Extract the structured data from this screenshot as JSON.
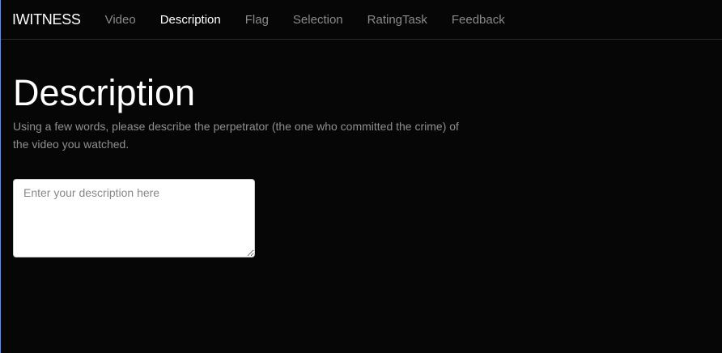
{
  "nav": {
    "brand": "IWITNESS",
    "items": [
      "Video",
      "Description",
      "Flag",
      "Selection",
      "RatingTask",
      "Feedback"
    ],
    "active": "Description"
  },
  "main": {
    "title": "Description",
    "instructions": "Using a few words, please describe the perpetrator (the one who committed the crime) of the video you watched.",
    "textarea": {
      "value": "",
      "placeholder": "Enter your description here"
    }
  }
}
